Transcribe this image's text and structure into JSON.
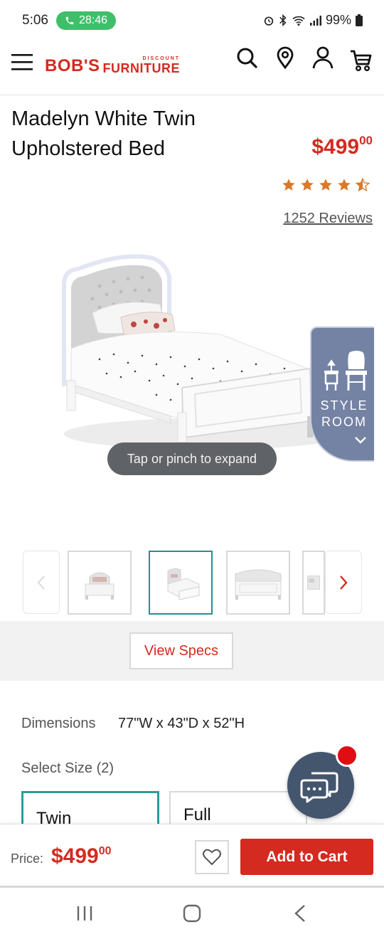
{
  "status_bar": {
    "time": "5:06",
    "call_timer": "28:46",
    "battery": "99%"
  },
  "header": {
    "logo_main": "BOB'S",
    "logo_discount": "DISCOUNT",
    "logo_furniture": "FURNITURE"
  },
  "product": {
    "title": "Madelyn White Twin Upholstered Bed",
    "price_dollars": "$499",
    "price_cents": "00",
    "rating": 4.5,
    "reviews": "1252 Reviews",
    "expand_hint": "Tap or pinch to expand",
    "style_room": "STYLE\nROOM"
  },
  "thumbnails": {
    "selected_index": 1,
    "count_visible": 4
  },
  "specs": {
    "view_specs": "View Specs",
    "dimensions_label": "Dimensions",
    "dimensions_value": "77\"W x 43\"D x 52\"H",
    "select_size": "Select Size (2)",
    "sizes": [
      {
        "label": "Twin",
        "selected": true
      },
      {
        "label": "Full",
        "selected": false
      }
    ]
  },
  "purchase_bar": {
    "price_label": "Price:",
    "price_dollars": "$499",
    "price_cents": "00",
    "add_to_cart": "Add to Cart"
  },
  "colors": {
    "brand_red": "#d32b21",
    "accent_teal": "#2a9c9c",
    "style_room_bg": "#7482a4",
    "star": "#d9792a",
    "chat_bg": "#44556e"
  }
}
